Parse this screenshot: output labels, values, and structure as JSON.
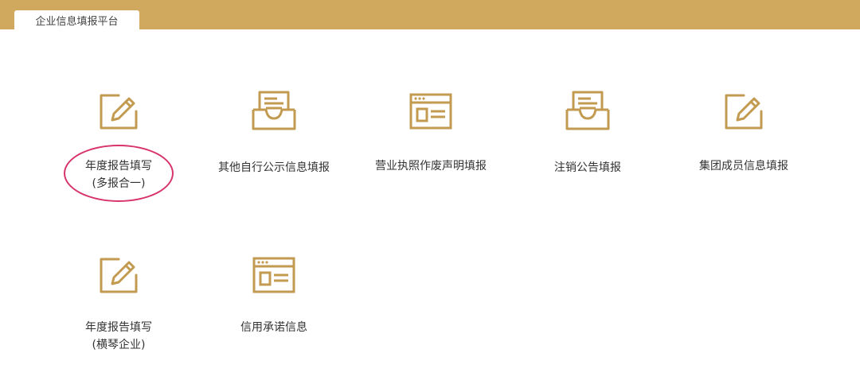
{
  "header": {
    "tab_label": "企业信息填报平台"
  },
  "tiles": [
    {
      "icon": "edit-pen-icon",
      "line1": "年度报告填写",
      "line2": "(多报合一)"
    },
    {
      "icon": "inbox-document-icon",
      "line1": "其他自行公示信息填报"
    },
    {
      "icon": "web-form-icon",
      "line1": "营业执照作废声明填报"
    },
    {
      "icon": "inbox-document-icon",
      "line1": "注销公告填报"
    },
    {
      "icon": "edit-pen-icon",
      "line1": "集团成员信息填报"
    },
    {
      "icon": "edit-pen-icon",
      "line1": "年度报告填写",
      "line2": "(横琴企业)"
    },
    {
      "icon": "web-form-icon",
      "line1": "信用承诺信息"
    }
  ],
  "colors": {
    "accent": "#d1a95e",
    "icon": "#c29a50",
    "highlight_oval": "#d8336a"
  }
}
